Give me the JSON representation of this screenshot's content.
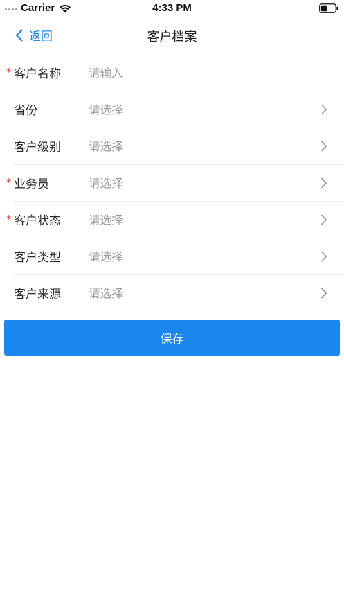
{
  "status_bar": {
    "carrier": "Carrier",
    "time": "4:33 PM"
  },
  "nav": {
    "back_label": "返回",
    "title": "客户档案"
  },
  "form": {
    "rows": [
      {
        "label": "客户名称",
        "value": "请输入",
        "required": true,
        "chevron": false
      },
      {
        "label": "省份",
        "value": "请选择",
        "required": false,
        "chevron": true
      },
      {
        "label": "客户级别",
        "value": "请选择",
        "required": false,
        "chevron": true
      },
      {
        "label": "业务员",
        "value": "请选择",
        "required": true,
        "chevron": true
      },
      {
        "label": "客户状态",
        "value": "请选择",
        "required": true,
        "chevron": true
      },
      {
        "label": "客户类型",
        "value": "请选择",
        "required": false,
        "chevron": true
      },
      {
        "label": "客户来源",
        "value": "请选择",
        "required": false,
        "chevron": true
      }
    ],
    "required_mark": "*"
  },
  "save_label": "保存",
  "colors": {
    "accent": "#1a87f0",
    "required": "#e8382f",
    "placeholder": "#9a9a9a"
  },
  "icons": [
    "signal-icon",
    "wifi-icon",
    "battery-icon",
    "back-chevron-icon",
    "chevron-right-icon"
  ]
}
